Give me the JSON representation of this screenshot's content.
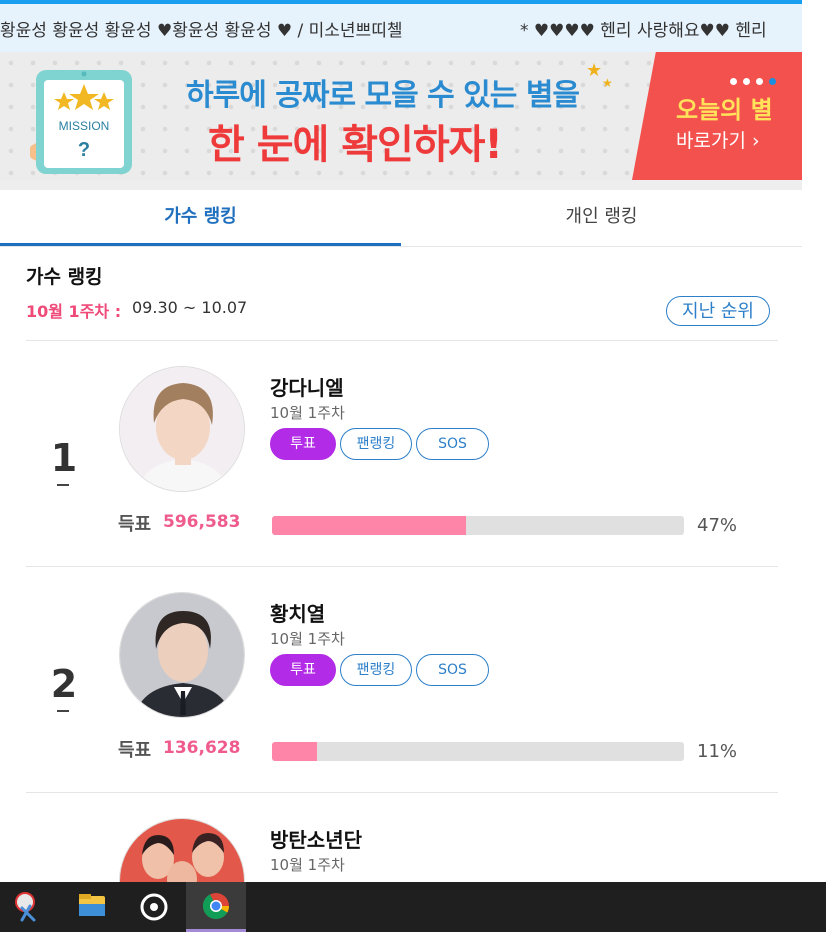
{
  "ticker": {
    "text_left": "황윤성 황윤성 황윤성 ♥황윤성 황윤성 ♥ / 미소년쁘띠첼",
    "text_right": "* ♥♥♥♥ 헨리 사랑해요♥♥ 헨리"
  },
  "banner": {
    "line1": "하루에 공짜로 모을 수 있는 별을",
    "line2": "한 눈에 확인하자!",
    "mission_label": "MISSION",
    "mission_mark": "?",
    "cta_title": "오늘의 별",
    "cta_link": "바로가기 ›",
    "slide_count": 4,
    "active_slide": 4
  },
  "tabs": [
    {
      "label": "가수 랭킹",
      "active": true
    },
    {
      "label": "개인 랭킹",
      "active": false
    }
  ],
  "section": {
    "title": "가수 랭킹",
    "week_label": "10월 1주차 :",
    "date_range": "09.30 ~ 10.07",
    "prev_button": "지난 순위"
  },
  "entries": [
    {
      "rank": "1",
      "name": "강다니엘",
      "week": "10월 1주차",
      "buttons": {
        "vote": "투표",
        "fan": "팬랭킹",
        "sos": "SOS"
      },
      "votes_label": "득표",
      "votes": "596,583",
      "percent": "47%",
      "share": 47
    },
    {
      "rank": "2",
      "name": "황치열",
      "week": "10월 1주차",
      "buttons": {
        "vote": "투표",
        "fan": "팬랭킹",
        "sos": "SOS"
      },
      "votes_label": "득표",
      "votes": "136,628",
      "percent": "11%",
      "share": 11
    },
    {
      "name": "방탄소년단",
      "week": "10월 1주차"
    }
  ],
  "colors": {
    "accent_blue": "#1f6fbf",
    "vote_purple": "#b22be6",
    "pink": "#ef5b8c",
    "bar_fill": "#ff85a8"
  },
  "taskbar": {
    "icons": [
      "snipping-tool-icon",
      "file-explorer-icon",
      "groove-music-icon",
      "chrome-icon"
    ],
    "active": "chrome-icon"
  }
}
